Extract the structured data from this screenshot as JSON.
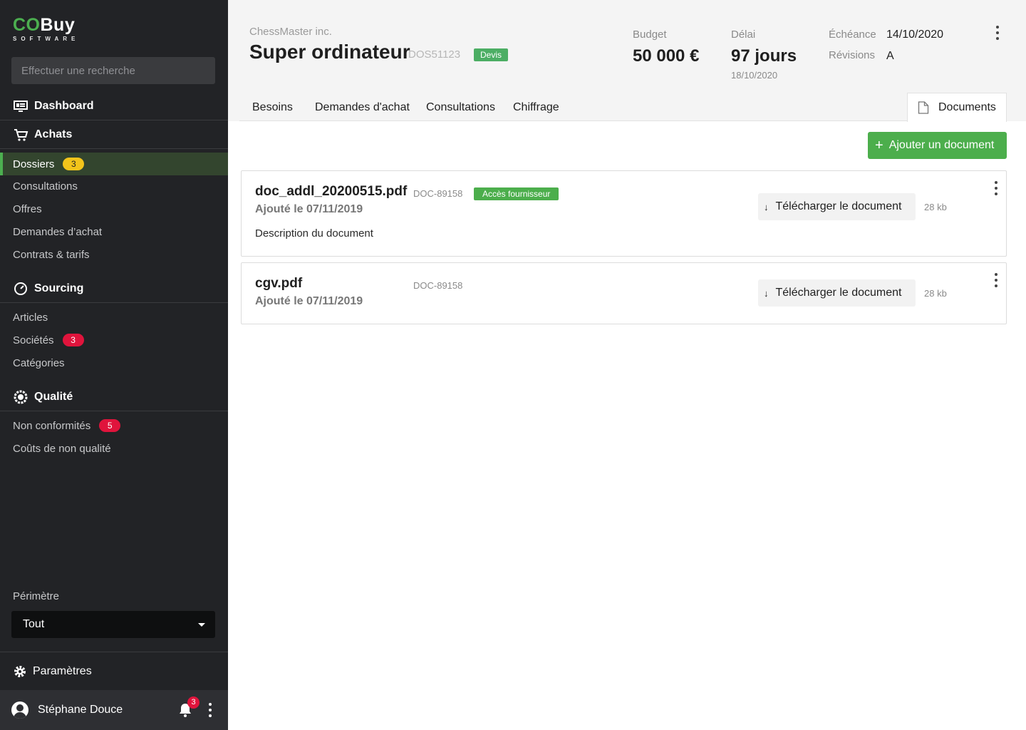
{
  "brand": {
    "part1": "CO",
    "part2": "Buy",
    "sub": "SOFTWARE"
  },
  "search": {
    "placeholder": "Effectuer une recherche"
  },
  "sidebar": {
    "dashboard": "Dashboard",
    "achats": {
      "label": "Achats",
      "items": [
        {
          "label": "Dossiers",
          "badge": "3"
        },
        {
          "label": "Consultations"
        },
        {
          "label": "Offres"
        },
        {
          "label": "Demandes d’achat"
        },
        {
          "label": "Contrats & tarifs"
        }
      ]
    },
    "sourcing": {
      "label": "Sourcing",
      "items": [
        {
          "label": "Articles"
        },
        {
          "label": "Sociétés",
          "badge": "3"
        },
        {
          "label": "Catégories"
        }
      ]
    },
    "qualite": {
      "label": "Qualité",
      "items": [
        {
          "label": "Non conformités",
          "badge": "5"
        },
        {
          "label": "Coûts de non qualité"
        }
      ]
    },
    "perimetre": {
      "label": "Périmètre",
      "value": "Tout"
    },
    "parametres": "Paramètres",
    "user": {
      "name": "Stéphane Douce",
      "notifications": "3"
    }
  },
  "header": {
    "company": "ChessMaster inc.",
    "title": "Super ordinateur",
    "ref": "DOS51123",
    "status": "Devis",
    "budget_label": "Budget",
    "budget_value": "50 000 €",
    "delai_label": "Délai",
    "delai_value": "97 jours",
    "delai_date": "18/10/2020",
    "echeance_label": "Échéance",
    "echeance_value": "14/10/2020",
    "revisions_label": "Révisions",
    "revisions_value": "A"
  },
  "tabs": [
    "Besoins",
    "Demandes d'achat",
    "Consultations",
    "Chiffrage",
    "Documents"
  ],
  "active_tab": "Documents",
  "actions": {
    "add_document": "Ajouter un document"
  },
  "documents": [
    {
      "name": "doc_addl_20200515.pdf",
      "id": "DOC-89158",
      "tag": "Accès fournisseur",
      "added": "Ajouté le 07/11/2019",
      "description": "Description du document",
      "download": "Télécharger le document",
      "size": "28 kb"
    },
    {
      "name": "cgv.pdf",
      "id": "DOC-89158",
      "added": "Ajouté le 07/11/2019",
      "download": "Télécharger le document",
      "size": "28 kb"
    }
  ],
  "colors": {
    "accent": "#4cae4c",
    "sidebar_bg": "#222326",
    "badge_red": "#e0143c",
    "badge_yellow": "#f3c41b"
  }
}
